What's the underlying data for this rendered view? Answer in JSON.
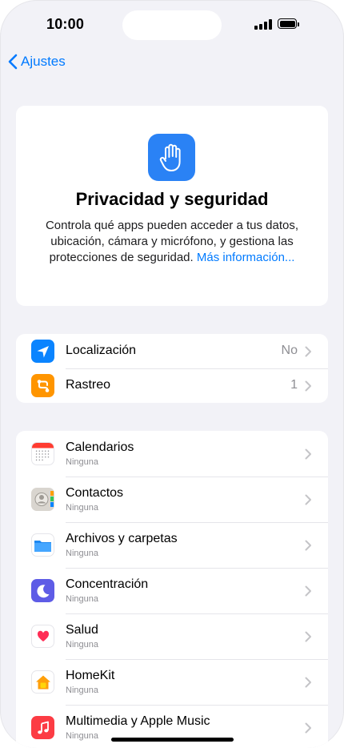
{
  "status": {
    "time": "10:00"
  },
  "nav": {
    "back_label": "Ajustes"
  },
  "header": {
    "title": "Privacidad y seguridad",
    "description": "Controla qué apps pueden acceder a tus datos, ubicación, cámara y micrófono, y gestiona las protecciones de seguridad.",
    "more_link": "Más información..."
  },
  "group_a": [
    {
      "label": "Localización",
      "value": "No",
      "icon": "location-arrow-icon",
      "color": "#0a84ff"
    },
    {
      "label": "Rastreo",
      "value": "1",
      "icon": "tracking-icon",
      "color": "#ff9500"
    }
  ],
  "group_b": [
    {
      "label": "Calendarios",
      "sub": "Ninguna",
      "icon": "calendar-icon"
    },
    {
      "label": "Contactos",
      "sub": "Ninguna",
      "icon": "contacts-icon"
    },
    {
      "label": "Archivos y carpetas",
      "sub": "Ninguna",
      "icon": "folder-icon"
    },
    {
      "label": "Concentración",
      "sub": "Ninguna",
      "icon": "moon-icon",
      "color": "#5e5ce6"
    },
    {
      "label": "Salud",
      "sub": "Ninguna",
      "icon": "heart-icon"
    },
    {
      "label": "HomeKit",
      "sub": "Ninguna",
      "icon": "home-icon"
    },
    {
      "label": "Multimedia y Apple Music",
      "sub": "Ninguna",
      "icon": "music-icon",
      "color": "#fc3c44"
    }
  ]
}
